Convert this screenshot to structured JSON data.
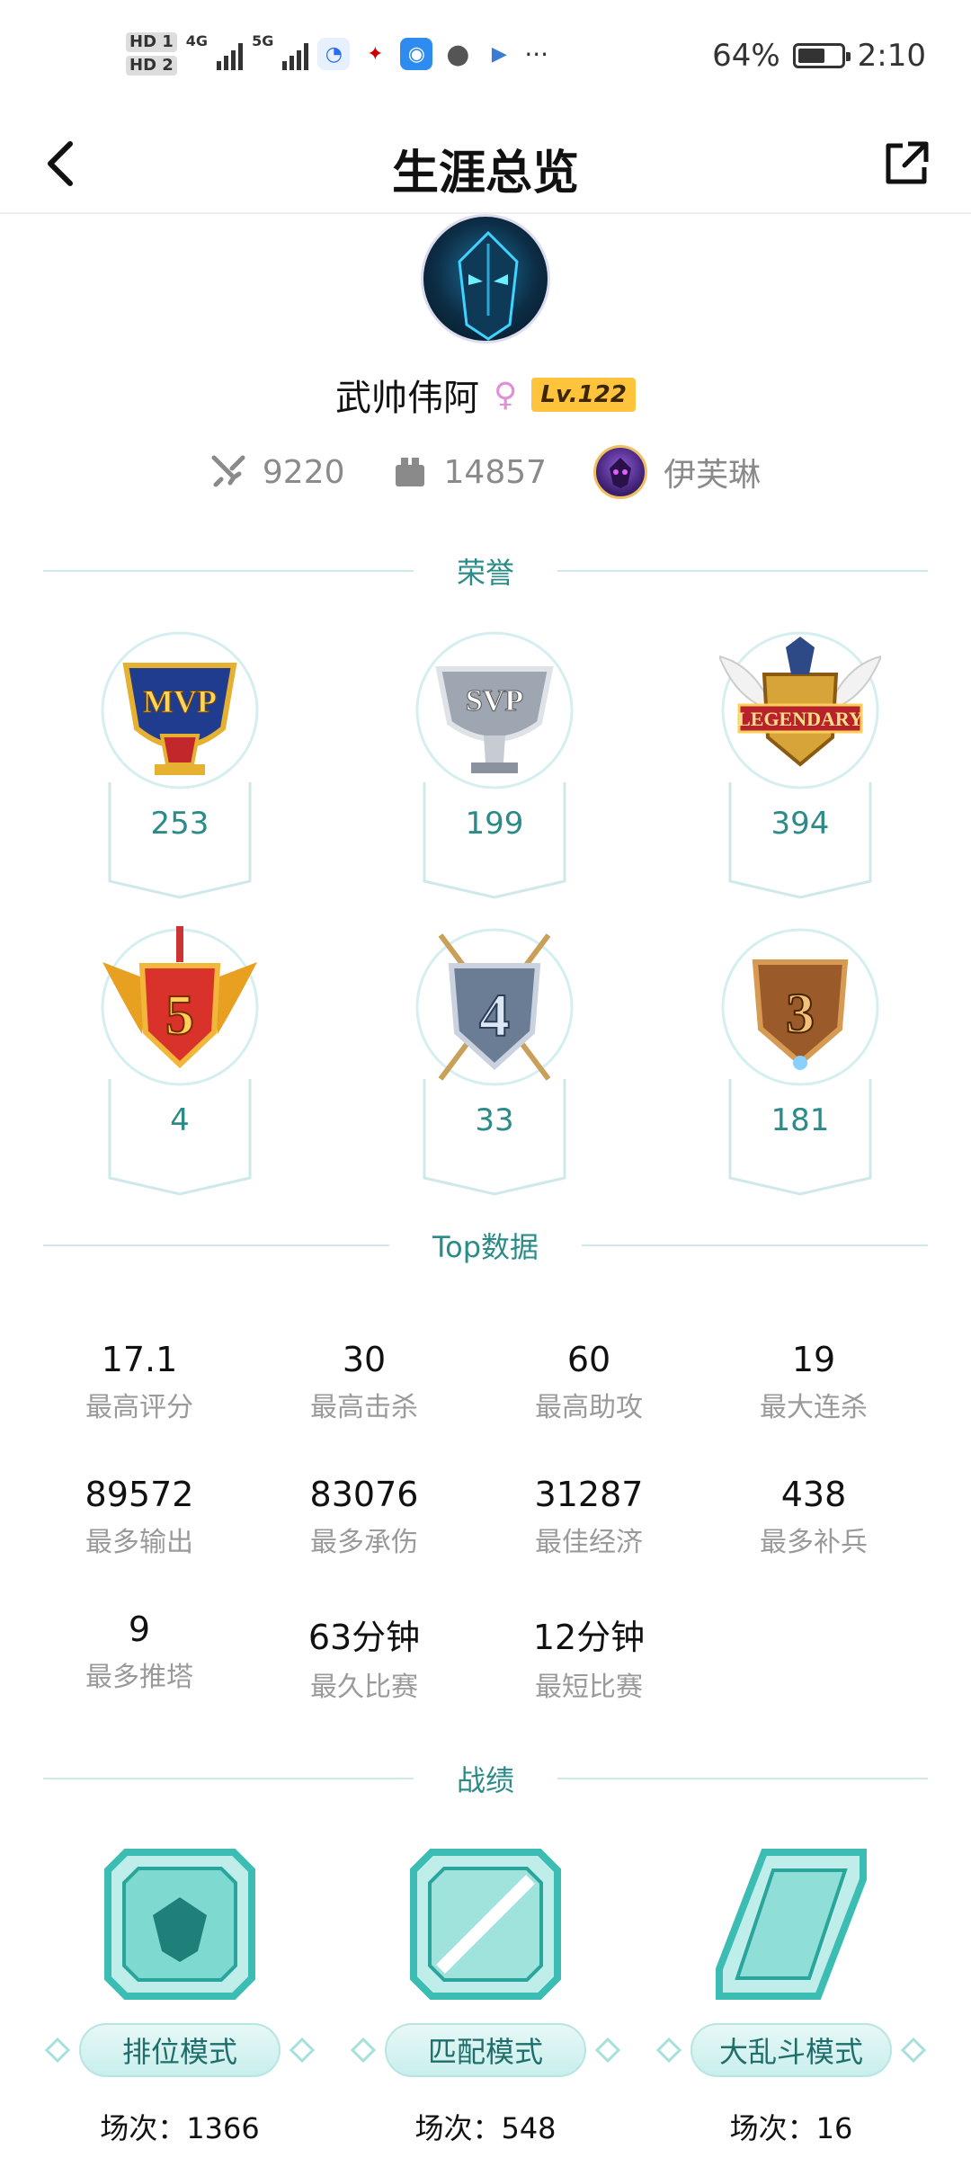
{
  "status_bar": {
    "hd1": "HD 1",
    "hd2": "HD 2",
    "net1": "4G",
    "net2": "5G",
    "more": "···",
    "battery": "64%",
    "battery_level": 0.64,
    "time": "2:10"
  },
  "header": {
    "title": "生涯总览"
  },
  "profile": {
    "name": "武帅伟阿",
    "gender_symbol": "♀",
    "level": "Lv.122",
    "stat1": "9220",
    "stat2": "14857",
    "hero": "伊芙琳"
  },
  "sections": {
    "honors": "荣誉",
    "top": "Top数据",
    "records": "战绩"
  },
  "honors": [
    {
      "medal": "MVP",
      "count": "253"
    },
    {
      "medal": "SVP",
      "count": "199"
    },
    {
      "medal": "LEGENDARY",
      "count": "394"
    },
    {
      "medal": "5",
      "count": "4"
    },
    {
      "medal": "4",
      "count": "33"
    },
    {
      "medal": "3",
      "count": "181"
    }
  ],
  "top_stats": [
    {
      "value": "17.1",
      "label": "最高评分"
    },
    {
      "value": "30",
      "label": "最高击杀"
    },
    {
      "value": "60",
      "label": "最高助攻"
    },
    {
      "value": "19",
      "label": "最大连杀"
    },
    {
      "value": "89572",
      "label": "最多输出"
    },
    {
      "value": "83076",
      "label": "最多承伤"
    },
    {
      "value": "31287",
      "label": "最佳经济"
    },
    {
      "value": "438",
      "label": "最多补兵"
    },
    {
      "value": "9",
      "label": "最多推塔"
    },
    {
      "value": "63分钟",
      "label": "最久比赛"
    },
    {
      "value": "12分钟",
      "label": "最短比赛"
    }
  ],
  "modes": [
    {
      "label": "排位模式",
      "games": "场次：1366"
    },
    {
      "label": "匹配模式",
      "games": "场次：548"
    },
    {
      "label": "大乱斗模式",
      "games": "场次：16"
    }
  ],
  "colors": {
    "accent": "#2b8b88",
    "divider": "#cfe9ea",
    "level_badge": "#ffc43c",
    "gender": "#e38fd6"
  }
}
